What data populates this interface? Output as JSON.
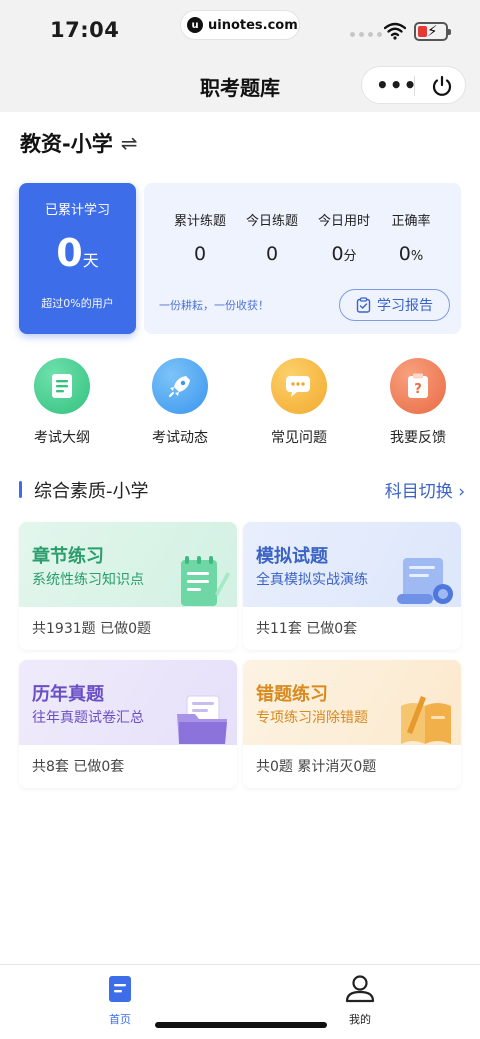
{
  "status_bar": {
    "time": "17:04",
    "url": "uinotes.com"
  },
  "navbar": {
    "title": "职考题库",
    "more_icon": "more-dots-icon",
    "close_icon": "power-icon"
  },
  "header": {
    "exam_type": "教资-小学",
    "switch_icon": "swap-arrows-icon"
  },
  "study": {
    "label": "已累计学习",
    "days": "0",
    "unit": "天",
    "subtitle": "超过0%的用户"
  },
  "stats": [
    {
      "label": "累计练题",
      "value": "0",
      "unit": ""
    },
    {
      "label": "今日练题",
      "value": "0",
      "unit": ""
    },
    {
      "label": "今日用时",
      "value": "0",
      "unit": "分"
    },
    {
      "label": "正确率",
      "value": "0",
      "unit": "%"
    }
  ],
  "slogan": "一份耕耘，一份收获！",
  "report_button": "学习报告",
  "menu": [
    {
      "label": "考试大纲",
      "icon": "document-icon",
      "color": "#3fc88a"
    },
    {
      "label": "考试动态",
      "icon": "rocket-icon",
      "color": "#3f9ef0"
    },
    {
      "label": "常见问题",
      "icon": "chat-bubble-icon",
      "color": "#f6b73c"
    },
    {
      "label": "我要反馈",
      "icon": "clipboard-question-icon",
      "color": "#ee7b52"
    }
  ],
  "section": {
    "title": "综合素质-小学",
    "switch_label": "科目切换"
  },
  "cards": [
    {
      "title": "章节练习",
      "subtitle": "系统性练习知识点",
      "stat": "共1931题 已做0题",
      "title_color": "#2b9d6c",
      "bg": "#e6f7ef",
      "icon": "notebook-pen-icon"
    },
    {
      "title": "模拟试题",
      "subtitle": "全真模拟实战演练",
      "stat": "共11套 已做0套",
      "title_color": "#3b63c6",
      "bg": "#e9effc",
      "icon": "scroll-stamp-icon"
    },
    {
      "title": "历年真题",
      "subtitle": "往年真题试卷汇总",
      "stat": "共8套 已做0套",
      "title_color": "#6a4fc4",
      "bg": "#efebfb",
      "icon": "folder-papers-icon"
    },
    {
      "title": "错题练习",
      "subtitle": "专项练习消除错题",
      "stat": "共0题 累计消灭0题",
      "title_color": "#d88a1e",
      "bg": "#fdf3e3",
      "icon": "book-pencil-icon"
    }
  ],
  "tabbar": [
    {
      "label": "首页",
      "icon": "home-doc-icon",
      "active": true,
      "color": "#3d6de8"
    },
    {
      "label": "我的",
      "icon": "user-icon",
      "active": false,
      "color": "#222222"
    }
  ]
}
